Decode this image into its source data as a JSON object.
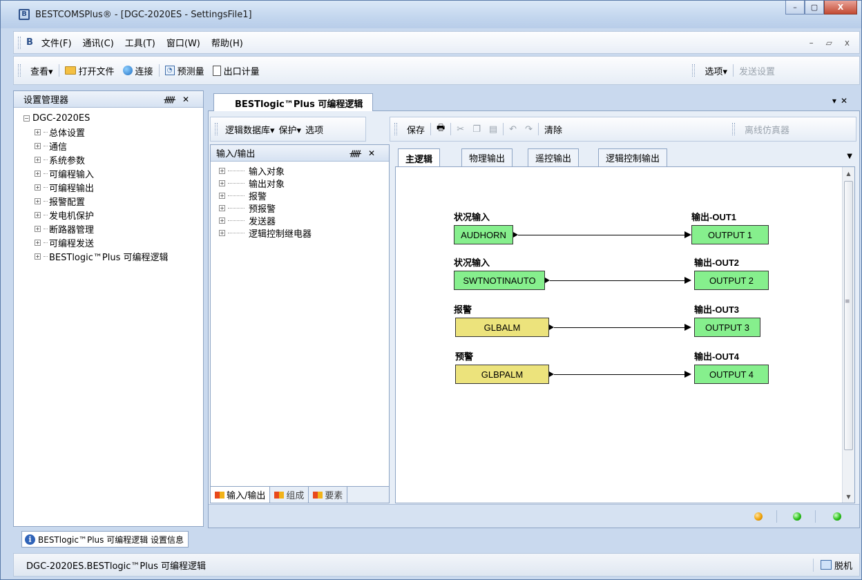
{
  "window": {
    "title": "BESTCOMSPlus® - [DGC-2020ES - SettingsFile1]",
    "controls": {
      "minimize": "–",
      "maximize": "▢",
      "close": "X"
    }
  },
  "menubar": {
    "items": [
      "文件(F)",
      "通讯(C)",
      "工具(T)",
      "窗口(W)",
      "帮助(H)"
    ],
    "mdi": {
      "minimize": "–",
      "restore": "▱",
      "close": "x"
    }
  },
  "toolbar": {
    "view": "查看▾",
    "open_file": "打开文件",
    "connect": "连接",
    "metering": "预测量",
    "export_metering": "出口计量",
    "options": "选项▾",
    "send_settings": "发送设置"
  },
  "settings_panel": {
    "title": "设置管理器",
    "root": "DGC-2020ES",
    "items": [
      "总体设置",
      "通信",
      "系统参数",
      "可编程输入",
      "可编程输出",
      "报警配置",
      "发电机保护",
      "断路器管理",
      "可编程发送",
      "BESTlogic™Plus 可编程逻辑"
    ]
  },
  "document": {
    "tab_title": "BESTlogic™Plus 可编程逻辑",
    "logic_toolbar": {
      "library": "逻辑数据库▾",
      "protect": "保护▾",
      "options": "选项"
    },
    "edit_toolbar": {
      "save": "保存",
      "clear": "清除",
      "offline_sim": "离线仿真器"
    }
  },
  "io_panel": {
    "title": "输入/输出",
    "items": [
      "输入对象",
      "输出对象",
      "报警",
      "预报警",
      "发送器",
      "逻辑控制继电器"
    ],
    "tabs": [
      "输入/输出",
      "组成",
      "要素"
    ]
  },
  "logic_tabs": [
    "主逻辑",
    "物理输出",
    "遥控输出",
    "逻辑控制输出"
  ],
  "logic_diagram": {
    "rows": [
      {
        "input_label": "状况输入",
        "input_name": "AUDHORN",
        "input_color": "#86ef8d",
        "output_label": "输出-OUT1",
        "output_name": "OUTPUT 1"
      },
      {
        "input_label": "状况输入",
        "input_name": "SWTNOTINAUTO",
        "input_color": "#86ef8d",
        "output_label": "输出-OUT2",
        "output_name": "OUTPUT 2"
      },
      {
        "input_label": "报警",
        "input_name": "GLBALM",
        "input_color": "#ece37c",
        "output_label": "输出-OUT3",
        "output_name": "OUTPUT 3"
      },
      {
        "input_label": "预警",
        "input_name": "GLBPALM",
        "input_color": "#ece37c",
        "output_label": "输出-OUT4",
        "output_name": "OUTPUT 4"
      }
    ]
  },
  "bottom_tab": "BESTlogic™Plus 可编程逻辑 设置信息",
  "statusbar": {
    "path": "DGC-2020ES.BESTlogic™Plus 可编程逻辑",
    "connection": "脱机"
  },
  "colors": {
    "led_1": "#f0a30a",
    "led_2": "#2cc21b",
    "led_3": "#2cc21b"
  }
}
